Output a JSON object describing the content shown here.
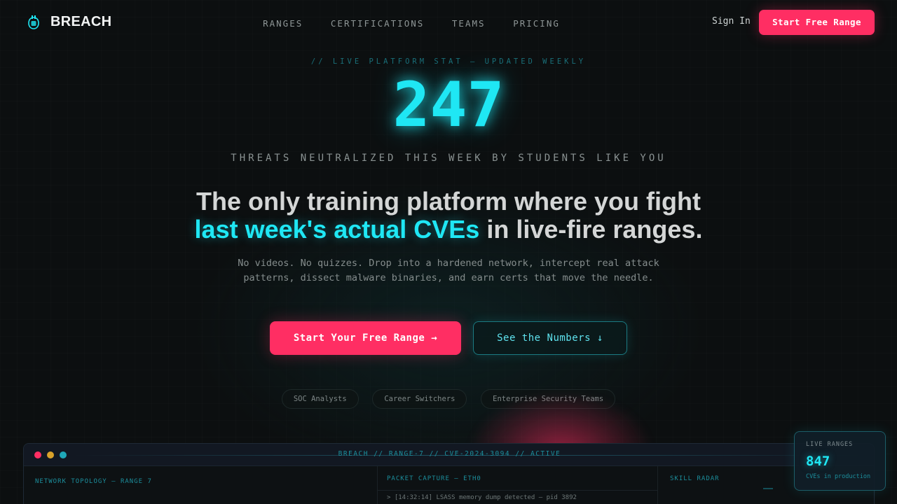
{
  "brand": {
    "name": "BREACH",
    "logo_icon": "shield-bug-icon",
    "accent": "#1fe7f4",
    "cta_color": "#ff2e63"
  },
  "nav": {
    "links": [
      "RANGES",
      "CERTIFICATIONS",
      "TEAMS",
      "PRICING"
    ],
    "sign_in": "Sign In",
    "cta": "Start Free Range"
  },
  "hero": {
    "eyebrow": "// LIVE PLATFORM STAT — UPDATED WEEKLY",
    "stat_value": "247",
    "stat_label": "THREATS NEUTRALIZED THIS WEEK BY STUDENTS LIKE YOU",
    "headline_line1": "The only training platform where you fight",
    "headline_accent": "last week's actual CVEs",
    "headline_rest": " in live-fire ranges.",
    "sub_line1": "No videos. No quizzes. Drop into a hardened network, intercept real attack",
    "sub_line2": "patterns, dissect malware binaries, and earn certs that move the needle.",
    "cta_primary": "Start Your Free Range →",
    "cta_secondary": "See the Numbers ↓",
    "audiences": [
      "SOC Analysts",
      "Career Switchers",
      "Enterprise Security Teams"
    ]
  },
  "dashboard": {
    "title": "BREACH // RANGE-7 // CVE-2024-3094 // ACTIVE",
    "panes": {
      "topology": "NETWORK TOPOLOGY — RANGE 7",
      "packet": "PACKET CAPTURE — ETH0",
      "radar": "SKILL RADAR"
    },
    "log_line": "> [14:32:14] LSASS memory dump detected — pid 3892"
  },
  "live_card": {
    "label": "LIVE RANGES",
    "value": "847",
    "sub": "CVEs in production"
  }
}
